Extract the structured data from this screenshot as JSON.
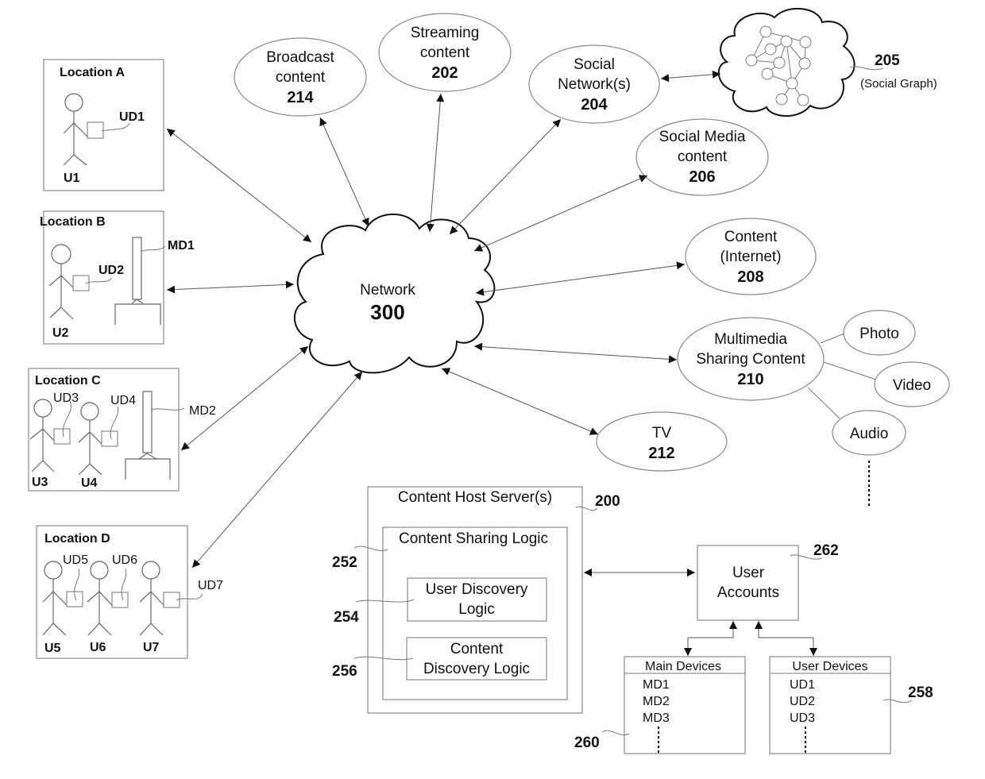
{
  "locations": [
    {
      "title": "Location A",
      "users": [
        "U1"
      ],
      "user_devices": [
        "UD1"
      ],
      "main_devices": []
    },
    {
      "title": "Location B",
      "users": [
        "U2"
      ],
      "user_devices": [
        "UD2"
      ],
      "main_devices": [
        "MD1"
      ]
    },
    {
      "title": "Location C",
      "users": [
        "U3",
        "U4"
      ],
      "user_devices": [
        "UD3",
        "UD4"
      ],
      "main_devices": [
        "MD2"
      ]
    },
    {
      "title": "Location D",
      "users": [
        "U5",
        "U6",
        "U7"
      ],
      "user_devices": [
        "UD5",
        "UD6",
        "UD7"
      ],
      "main_devices": []
    }
  ],
  "network": {
    "label": "Network",
    "ref": "300"
  },
  "content_nodes": {
    "broadcast": {
      "lines": [
        "Broadcast",
        "content"
      ],
      "ref": "214"
    },
    "streaming": {
      "lines": [
        "Streaming",
        "content"
      ],
      "ref": "202"
    },
    "social_networks": {
      "lines": [
        "Social",
        "Network(s)"
      ],
      "ref": "204"
    },
    "social_media": {
      "lines": [
        "Social Media",
        "content"
      ],
      "ref": "206"
    },
    "internet": {
      "lines": [
        "Content",
        "(Internet)"
      ],
      "ref": "208"
    },
    "multimedia": {
      "lines": [
        "Multimedia",
        "Sharing Content"
      ],
      "ref": "210"
    },
    "tv": {
      "lines": [
        "TV"
      ],
      "ref": "212"
    }
  },
  "social_graph": {
    "ref": "205",
    "label": "(Social Graph)"
  },
  "media_types": [
    "Photo",
    "Video",
    "Audio"
  ],
  "server": {
    "title": "Content Host Server(s)",
    "ref": "200",
    "sharing_logic": {
      "title": "Content Sharing Logic",
      "ref": "252"
    },
    "user_discovery": {
      "lines": [
        "User Discovery",
        "Logic"
      ],
      "ref": "254"
    },
    "content_discovery": {
      "lines": [
        "Content",
        "Discovery Logic"
      ],
      "ref": "256"
    }
  },
  "user_accounts": {
    "lines": [
      "User",
      "Accounts"
    ],
    "ref": "262"
  },
  "main_devices_table": {
    "header": "Main Devices",
    "items": [
      "MD1",
      "MD2",
      "MD3"
    ],
    "ref": "260"
  },
  "user_devices_table": {
    "header": "User Devices",
    "items": [
      "UD1",
      "UD2",
      "UD3"
    ],
    "ref": "258"
  }
}
